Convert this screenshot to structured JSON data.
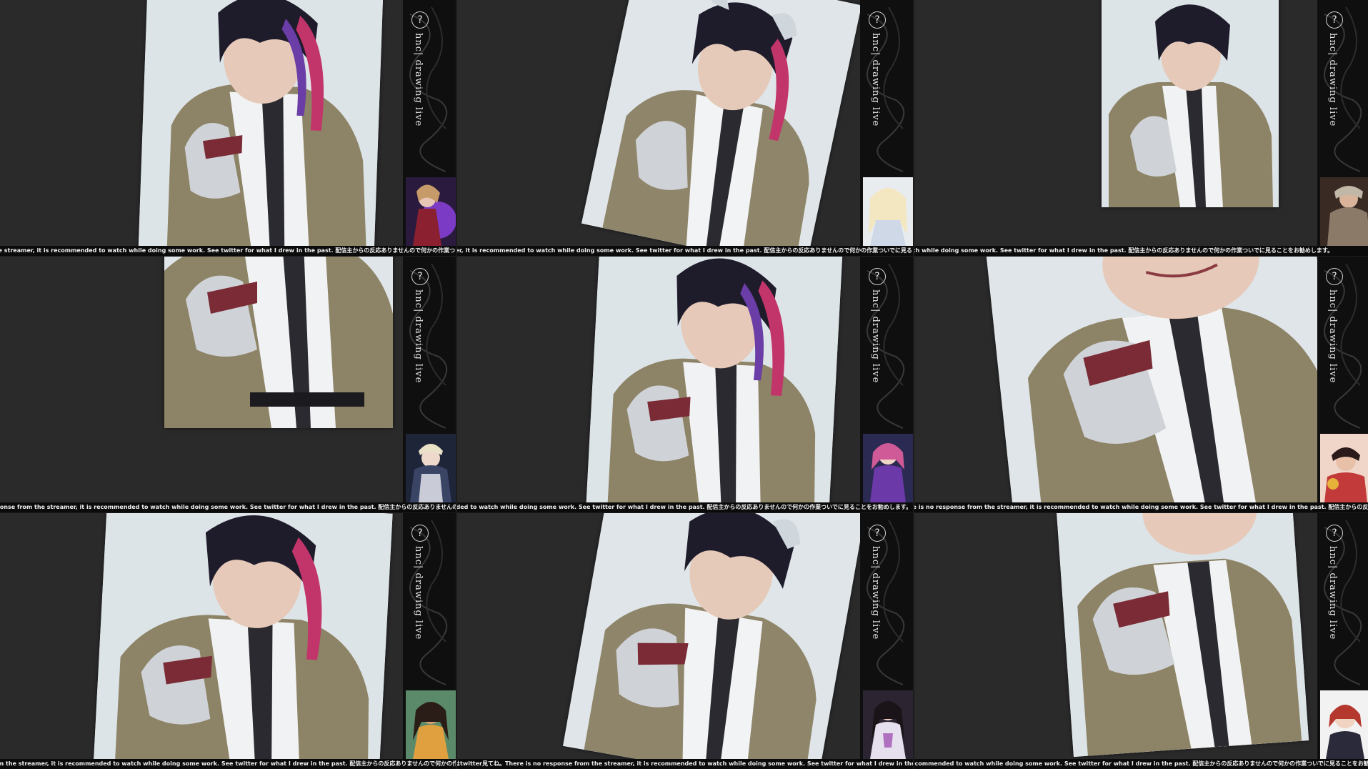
{
  "stream": {
    "channel_title": "hnc| drawing live",
    "help_glyph": "?",
    "ticker_text": "過去描いたものはtwitter見てね。There is no response from the streamer, it is recommended to watch while doing some work. See twitter for what I drew in the past. 配信主からの反応ありませんので何かの作業ついでに見ることをお勧めします。"
  },
  "colors": {
    "background": "#2b2b2b",
    "sidebar": "#0f0f0f",
    "ticker_bg": "#0b0b0b",
    "ticker_text": "#f0f0f0"
  },
  "icons": [
    "help-icon",
    "channel-swirl-icon"
  ],
  "frames": [
    {
      "thumbnail": "purple-flame-character"
    },
    {
      "thumbnail": "white-haired-character"
    },
    {
      "thumbnail": "armored-character"
    },
    {
      "thumbnail": "armored-knight-character"
    },
    {
      "thumbnail": "pink-haired-character"
    },
    {
      "thumbnail": "fighter-character"
    },
    {
      "thumbnail": "dark-haired-character"
    },
    {
      "thumbnail": "robed-character"
    },
    {
      "thumbnail": "red-haired-character"
    }
  ]
}
